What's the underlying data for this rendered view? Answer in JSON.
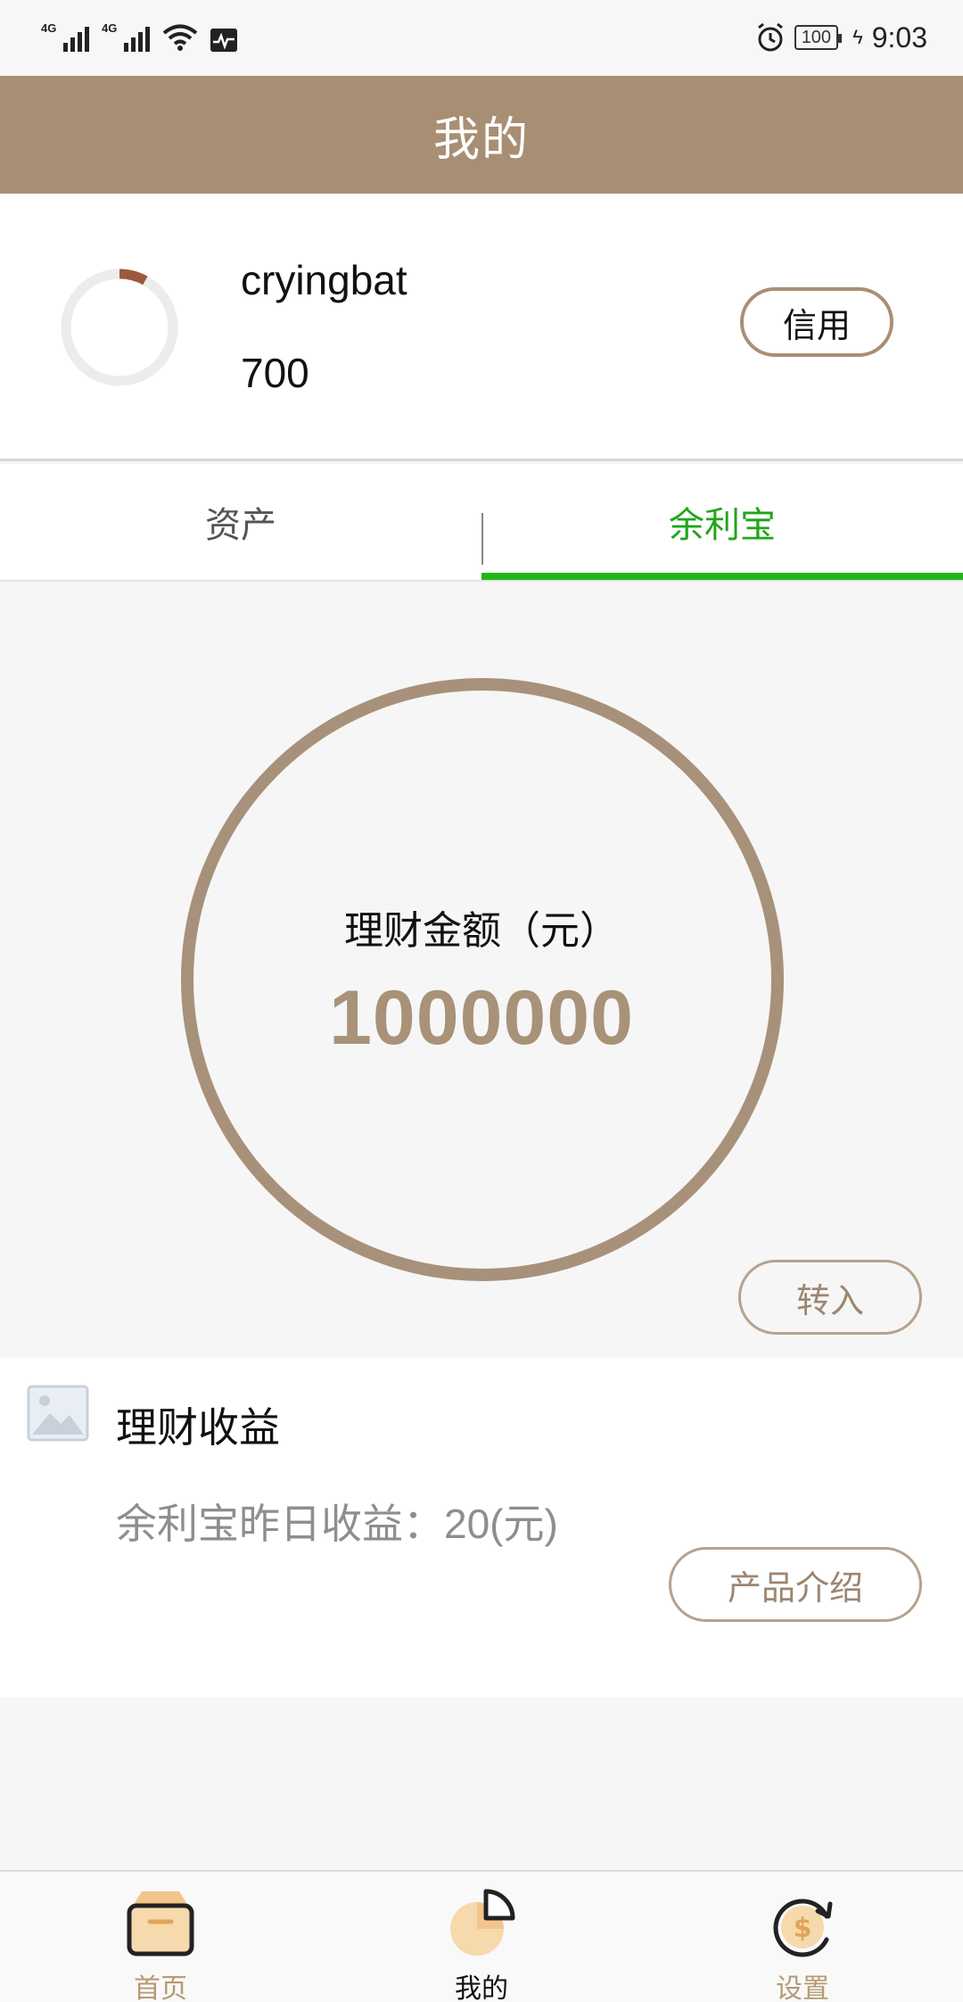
{
  "status_bar": {
    "network_1": "4G",
    "network_2": "4G",
    "battery": "100",
    "time": "9:03"
  },
  "header": {
    "title": "我的"
  },
  "profile": {
    "username": "cryingbat",
    "credit_score": "700",
    "credit_button": "信用",
    "credit_ring_fraction": 0.08,
    "credit_ring_color": "#9b5a3c"
  },
  "tabs": [
    {
      "label": "资产",
      "active": false
    },
    {
      "label": "余利宝",
      "active": true
    }
  ],
  "balance": {
    "label": "理财金额（元）",
    "amount": "1000000",
    "transfer_button": "转入"
  },
  "earnings": {
    "title": "理财收益",
    "yesterday": "余利宝昨日收益：20(元)",
    "intro_button": "产品介绍"
  },
  "bottom_nav": [
    {
      "label": "首页",
      "icon": "home-box-icon"
    },
    {
      "label": "我的",
      "icon": "pie-chart-icon"
    },
    {
      "label": "设置",
      "icon": "dollar-refresh-icon"
    }
  ],
  "colors": {
    "accent": "#a88f73",
    "active_tab": "#22a51b",
    "nav_inactive": "#b59a73",
    "nav_active": "#111111"
  }
}
